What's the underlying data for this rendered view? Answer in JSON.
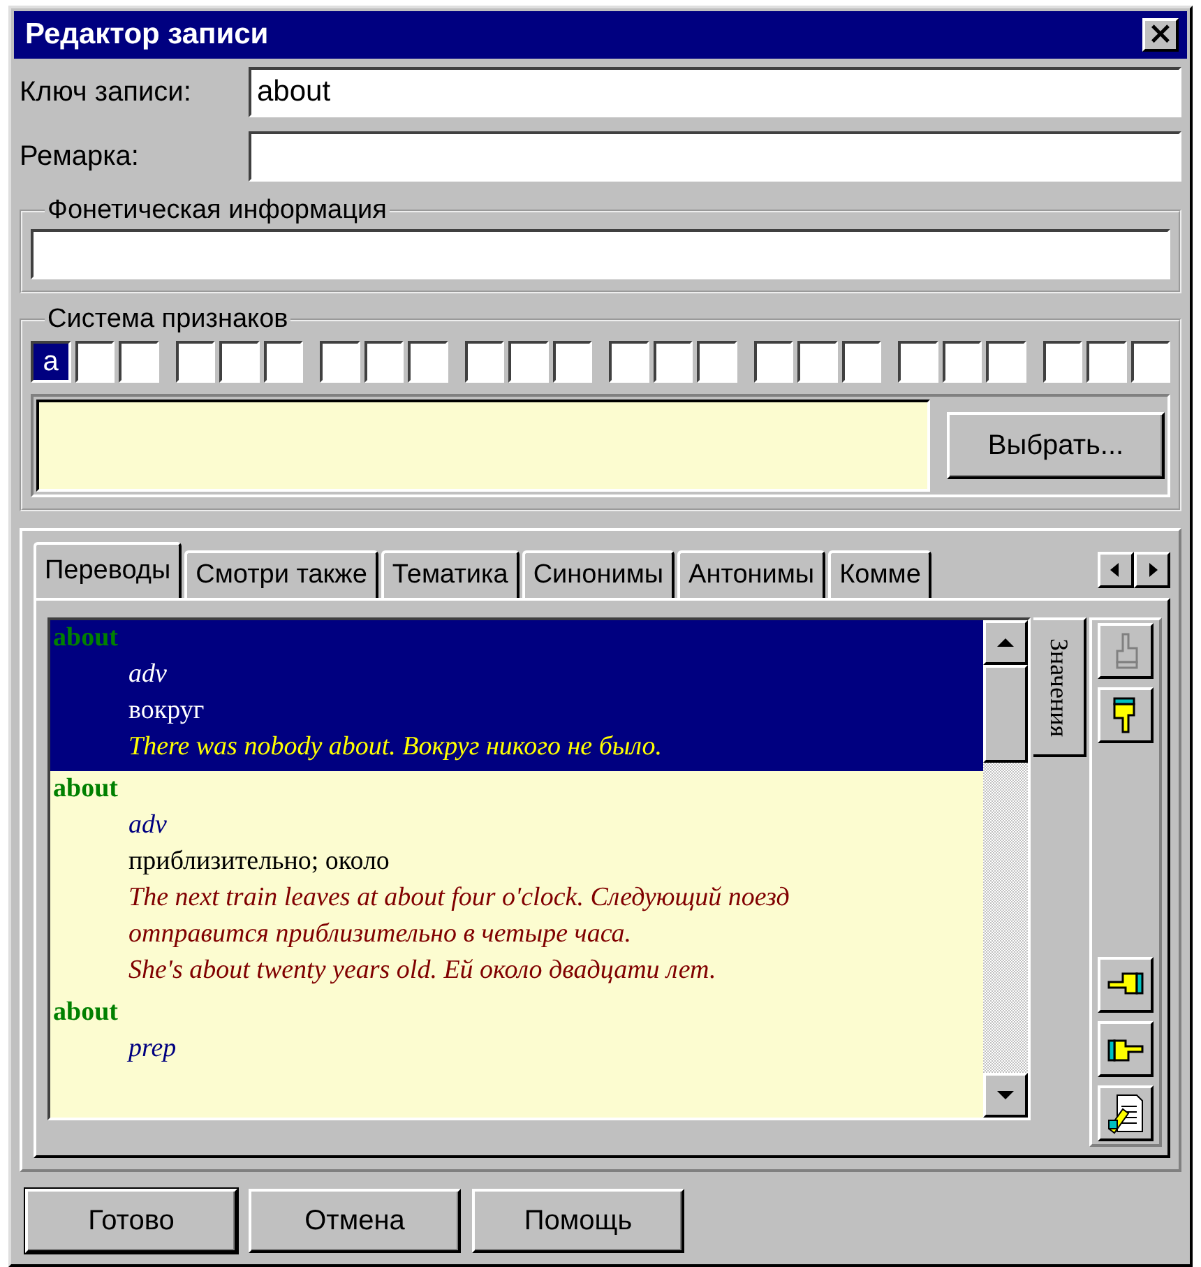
{
  "window": {
    "title": "Редактор записи",
    "close": "×"
  },
  "key": {
    "label": "Ключ записи:",
    "value": "about"
  },
  "remark": {
    "label": "Ремарка:"
  },
  "phonetic": {
    "title": "Фонетическая информация"
  },
  "features": {
    "title": "Система признаков",
    "choose_button": "Выбрать...",
    "groups": [
      {
        "cells": [
          {
            "text": "a",
            "selected": true
          },
          {
            "selected": false
          },
          {
            "selected": false
          }
        ]
      },
      {
        "cells": [
          {
            "selected": false
          },
          {
            "selected": false
          },
          {
            "selected": false
          }
        ]
      },
      {
        "cells": [
          {
            "selected": false
          },
          {
            "selected": false
          },
          {
            "selected": false
          }
        ]
      },
      {
        "cells": [
          {
            "selected": false
          },
          {
            "selected": false
          },
          {
            "selected": false
          }
        ]
      },
      {
        "cells": [
          {
            "selected": false
          },
          {
            "selected": false
          },
          {
            "selected": false
          }
        ]
      },
      {
        "cells": [
          {
            "selected": false
          },
          {
            "selected": false
          },
          {
            "selected": false
          }
        ]
      },
      {
        "cells": [
          {
            "selected": false
          },
          {
            "selected": false
          },
          {
            "selected": false
          }
        ]
      },
      {
        "cells": [
          {
            "selected": false
          },
          {
            "selected": false
          },
          {
            "selected": false
          }
        ]
      }
    ]
  },
  "tabs": [
    {
      "label": "Переводы",
      "selected": true
    },
    {
      "label": "Смотри также",
      "selected": false
    },
    {
      "label": "Тематика",
      "selected": false
    },
    {
      "label": "Синонимы",
      "selected": false
    },
    {
      "label": "Антонимы",
      "selected": false
    },
    {
      "label": "Комме",
      "selected": false
    }
  ],
  "entries": [
    {
      "headword": "about",
      "pos": "adv",
      "translation": "вокруг",
      "examples": [
        "There was nobody about. Вокруг никого не было."
      ],
      "selected": true
    },
    {
      "headword": "about",
      "pos": "adv",
      "translation": "приблизительно; около",
      "examples": [
        "The next train leaves at about four o'clock. Следующий поезд отправится приблизительно в четыре часа.",
        "She's about twenty years old. Ей около двадцати лет."
      ],
      "selected": false
    },
    {
      "headword": "about",
      "pos": "prep",
      "selected": false
    }
  ],
  "side_tab": {
    "label": "Значения"
  },
  "tools": [
    {
      "kind": "hand-up",
      "disabled": true
    },
    {
      "kind": "hand-down",
      "disabled": false
    },
    {
      "kind": "hand-left",
      "disabled": false
    },
    {
      "kind": "hand-right",
      "disabled": false
    },
    {
      "kind": "edit",
      "disabled": false
    }
  ],
  "buttons": [
    {
      "label": "Готово",
      "default": true
    },
    {
      "label": "Отмена",
      "default": false
    },
    {
      "label": "Помощь",
      "default": false
    }
  ]
}
